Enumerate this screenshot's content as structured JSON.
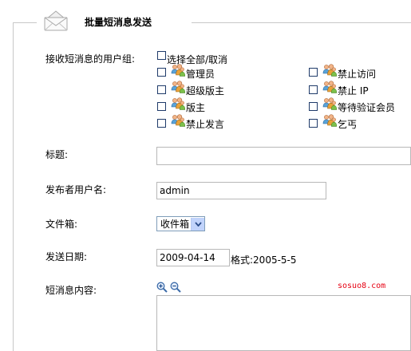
{
  "form": {
    "legend": "批量短消息发送",
    "groups_label": "接收短消息的用户组:",
    "select_all_label": "选择全部/取消",
    "groups": [
      {
        "label": "管理员"
      },
      {
        "label": "禁止访问"
      },
      {
        "label": "超级版主"
      },
      {
        "label": "禁止 IP"
      },
      {
        "label": "版主"
      },
      {
        "label": "等待验证会员"
      },
      {
        "label": "禁止发言"
      },
      {
        "label": "乞丐"
      }
    ],
    "title_label": "标题:",
    "title_value": "",
    "sender_label": "发布者用户名:",
    "sender_value": "admin",
    "folder_label": "文件箱:",
    "folder_value": "收件箱",
    "date_label": "发送日期:",
    "date_value": "2009-04-14",
    "date_format": "格式:2005-5-5",
    "content_label": "短消息内容:",
    "content_value": ""
  },
  "watermark": "sosuo8.com",
  "icons": {
    "header": "envelope-icon",
    "group": "user-group-icon",
    "zoom_in": "zoom-in-icon",
    "zoom_out": "zoom-out-icon",
    "dropdown": "chevron-down-icon"
  },
  "colors": {
    "checkbox_border": "#1f3b6a",
    "input_border": "#b8b8b8",
    "select_arrow_bg": "#c1d3fb",
    "watermark": "#e60012"
  }
}
